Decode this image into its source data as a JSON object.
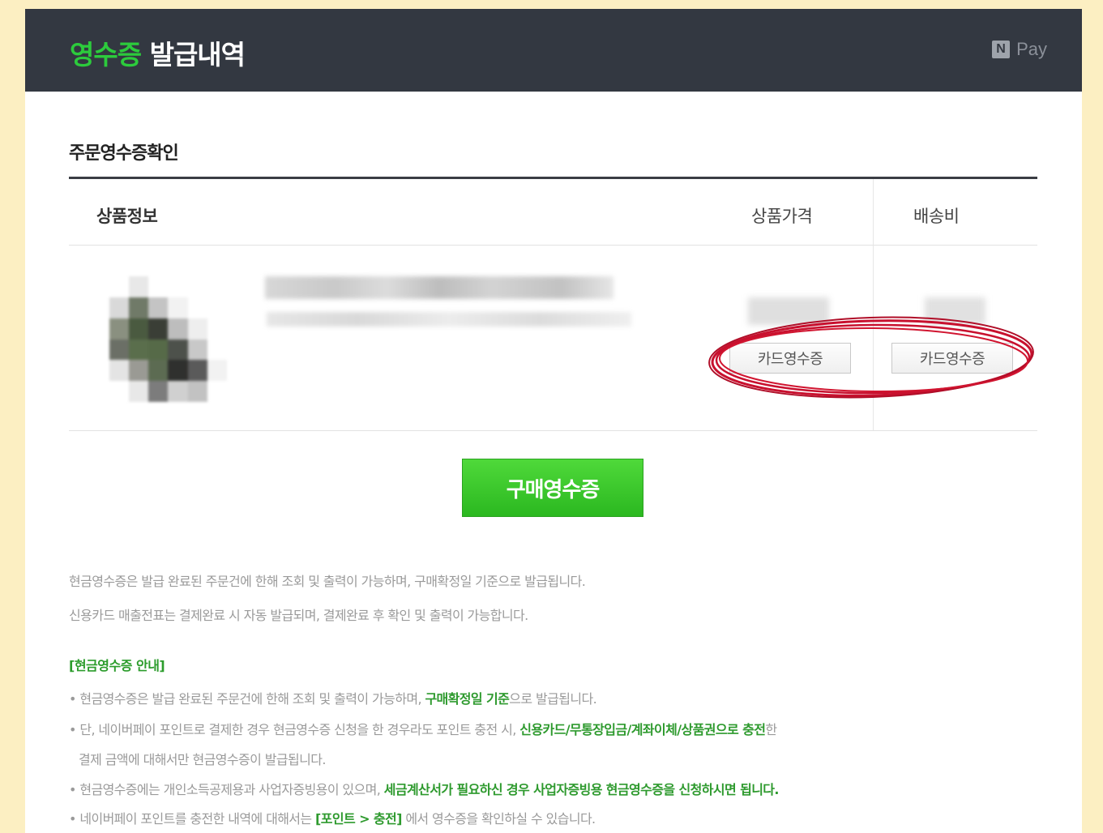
{
  "header": {
    "title_accent": "영수증",
    "title_rest": " 발급내역",
    "brand_logo": "N",
    "brand_text": "Pay"
  },
  "section": {
    "title": "주문영수증확인"
  },
  "table": {
    "headers": {
      "product": "상품정보",
      "price": "상품가격",
      "shipping": "배송비"
    },
    "row": {
      "price_button": "카드영수증",
      "shipping_button": "카드영수증"
    }
  },
  "buy_receipt_button": "구매영수증",
  "info": {
    "line1": "현금영수증은 발급 완료된 주문건에 한해 조회 및 출력이 가능하며, 구매확정일 기준으로 발급됩니다.",
    "line2": "신용카드 매출전표는 결제완료 시 자동 발급되며, 결제완료 후 확인 및 출력이 가능합니다."
  },
  "guide": {
    "title": "[현금영수증 안내]",
    "b1_a": "• 현금영수증은 발급 완료된 주문건에 한해 조회 및 출력이 가능하며, ",
    "b1_g": "구매확정일 기준",
    "b1_b": "으로 발급됩니다.",
    "b2_a": "• 단, 네이버페이 포인트로 결제한 경우 현금영수증 신청을 한 경우라도 포인트 충전 시, ",
    "b2_g": "신용카드/무통장입금/계좌이체/상품권으로 충전",
    "b2_b": "한",
    "b2c": "결제 금액에 대해서만 현금영수증이 발급됩니다.",
    "b3_a": "• 현금영수증에는 개인소득공제용과 사업자증빙용이 있으며, ",
    "b3_g": "세금계산서가 필요하신 경우 사업자증빙용 현금영수증을 신청하시면 됩니다.",
    "b4_a": "• 네이버페이 포인트를 충전한 내역에 대해서는 ",
    "b4_g": "[포인트 > 충전]",
    "b4_b": " 에서 영수증을 확인하실 수 있습니다."
  },
  "colors": {
    "accent_green": "#2ccb3c",
    "header_bg": "#333841",
    "annotation_red": "#c8102e",
    "page_bg": "#fcefc2"
  }
}
